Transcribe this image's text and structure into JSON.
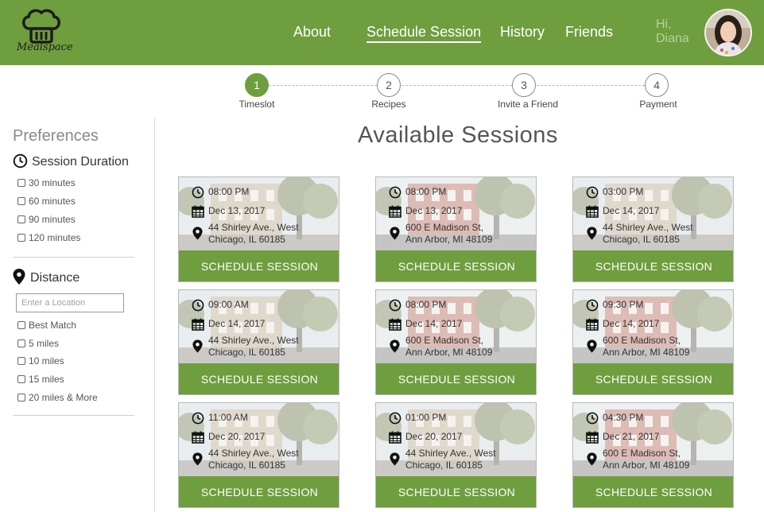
{
  "brand": {
    "name": "Mealspace"
  },
  "nav": {
    "items": [
      {
        "label": "About",
        "active": false
      },
      {
        "label": "Schedule Session",
        "active": true
      },
      {
        "label": "History",
        "active": false
      },
      {
        "label": "Friends",
        "active": false
      }
    ],
    "greeting_line1": "Hi,",
    "greeting_line2": "Diana"
  },
  "stepper": {
    "steps": [
      {
        "number": "1",
        "label": "Timeslot",
        "active": true
      },
      {
        "number": "2",
        "label": "Recipes",
        "active": false
      },
      {
        "number": "3",
        "label": "Invite a Friend",
        "active": false
      },
      {
        "number": "4",
        "label": "Payment",
        "active": false
      }
    ]
  },
  "sidebar": {
    "title": "Preferences",
    "duration": {
      "title": "Session Duration",
      "options": [
        "30 minutes",
        "60 minutes",
        "90 minutes",
        "120 minutes"
      ]
    },
    "distance": {
      "title": "Distance",
      "location_placeholder": "Enter a Location",
      "options": [
        "Best Match",
        "5 miles",
        "10 miles",
        "15 miles",
        "20 miles & More"
      ]
    }
  },
  "main": {
    "title": "Available Sessions",
    "button_label": "SCHEDULE SESSION",
    "sessions": [
      {
        "time": "08:00 PM",
        "date": "Dec 13, 2017",
        "address1": "44 Shirley Ave., West",
        "address2": "Chicago, IL 60185"
      },
      {
        "time": "08:00 PM",
        "date": "Dec 13, 2017",
        "address1": "600 E Madison St,",
        "address2": "Ann Arbor, MI 48109"
      },
      {
        "time": "03:00 PM",
        "date": "Dec 14, 2017",
        "address1": "44 Shirley Ave., West",
        "address2": "Chicago, IL 60185"
      },
      {
        "time": "09:00 AM",
        "date": "Dec 14, 2017",
        "address1": "44 Shirley Ave., West",
        "address2": "Chicago, IL 60185"
      },
      {
        "time": "08:00 PM",
        "date": "Dec 14, 2017",
        "address1": "600 E Madison St,",
        "address2": "Ann Arbor, MI 48109"
      },
      {
        "time": "09:30 PM",
        "date": "Dec 14, 2017",
        "address1": "600 E Madison St,",
        "address2": "Ann Arbor, MI 48109"
      },
      {
        "time": "11:00 AM",
        "date": "Dec 20, 2017",
        "address1": "44 Shirley Ave., West",
        "address2": "Chicago, IL 60185"
      },
      {
        "time": "01:00 PM",
        "date": "Dec 20, 2017",
        "address1": "44 Shirley Ave., West",
        "address2": "Chicago, IL 60185"
      },
      {
        "time": "04:30 PM",
        "date": "Dec 21, 2017",
        "address1": "600 E Madison St,",
        "address2": "Ann Arbor, MI 48109"
      }
    ]
  },
  "colors": {
    "accent": "#6e9e3e",
    "greeting": "#b7d39a",
    "text": "#444444"
  },
  "icons": {
    "logo": "chef-hat-icon",
    "time": "clock-icon",
    "date": "calendar-icon",
    "location": "map-pin-icon"
  }
}
